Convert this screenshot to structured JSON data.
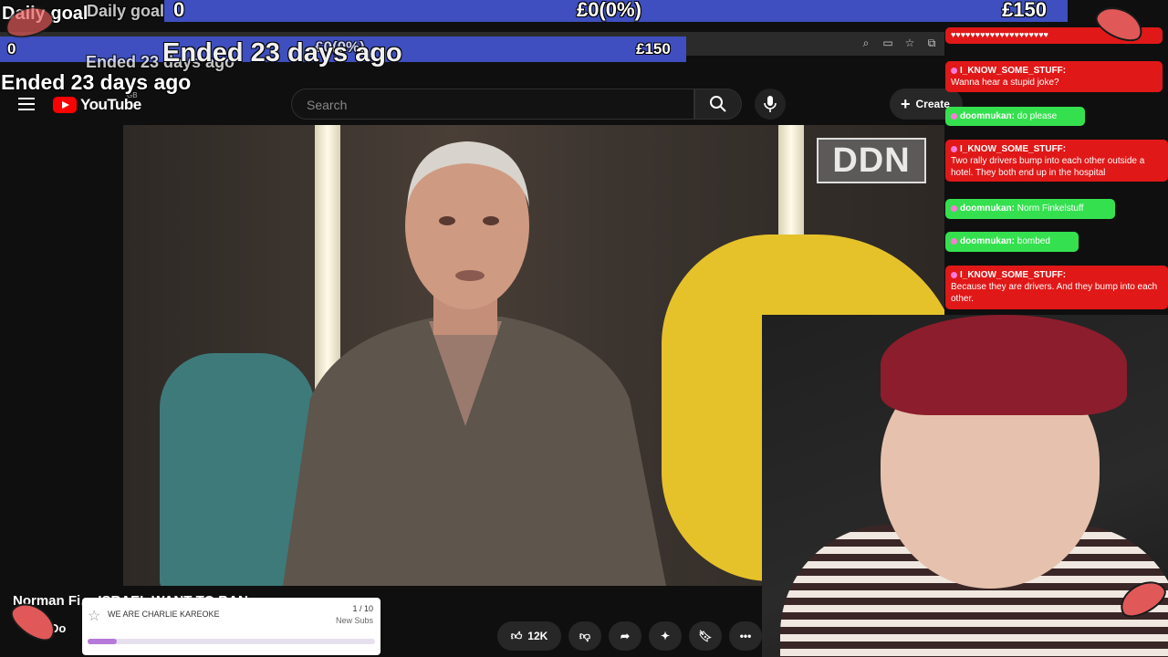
{
  "goals": {
    "title": "Daily goal",
    "current": "0",
    "percent": "£0(0%)",
    "target": "£150",
    "ended": "Ended 23 days ago",
    "progress_fraction": 0
  },
  "browser": {
    "icons": [
      "zoom-icon",
      "cast-icon",
      "star-icon",
      "extensions-icon"
    ]
  },
  "youtube": {
    "wordmark": "YouTube",
    "region": "GB",
    "search_placeholder": "Search",
    "create_label": "Create",
    "video_title": "Norman Fi… ISRAEL WANT TO BAN",
    "channel_abbrev": "Do",
    "likes": "12K",
    "video_logo": "DDN"
  },
  "chat": {
    "messages": [
      {
        "user": "I_KNOW_SOME_STUFF:",
        "text": "Wanna hear a stupid joke?",
        "style": "red"
      },
      {
        "user": "doomnukan:",
        "text": "do please",
        "style": "green"
      },
      {
        "user": "I_KNOW_SOME_STUFF:",
        "text": "Two rally drivers bump into each other outside a hotel. They both end up in the hospital",
        "style": "red"
      },
      {
        "user": "doomnukan:",
        "text": "Norm Finkelstuff",
        "style": "green"
      },
      {
        "user": "doomnukan:",
        "text": "bombed",
        "style": "green"
      },
      {
        "user": "I_KNOW_SOME_STUFF:",
        "text": "Because they are drivers. And they bump into each other.",
        "style": "red"
      }
    ],
    "top_hearts": "♥♥♥♥♥♥♥♥♥♥♥♥♥♥♥♥♥♥♥♥"
  },
  "subs_widget": {
    "title": "WE ARE CHARLIE KAREOKE",
    "count": "1 / 10",
    "label": "New Subs",
    "progress_fraction": 0.1
  },
  "colors": {
    "goal_bar": "#3f4fbf",
    "chat_red": "#e01818",
    "chat_green": "#35e04f",
    "youtube_red": "#ff0000",
    "subs_fill": "#b57ad9"
  }
}
